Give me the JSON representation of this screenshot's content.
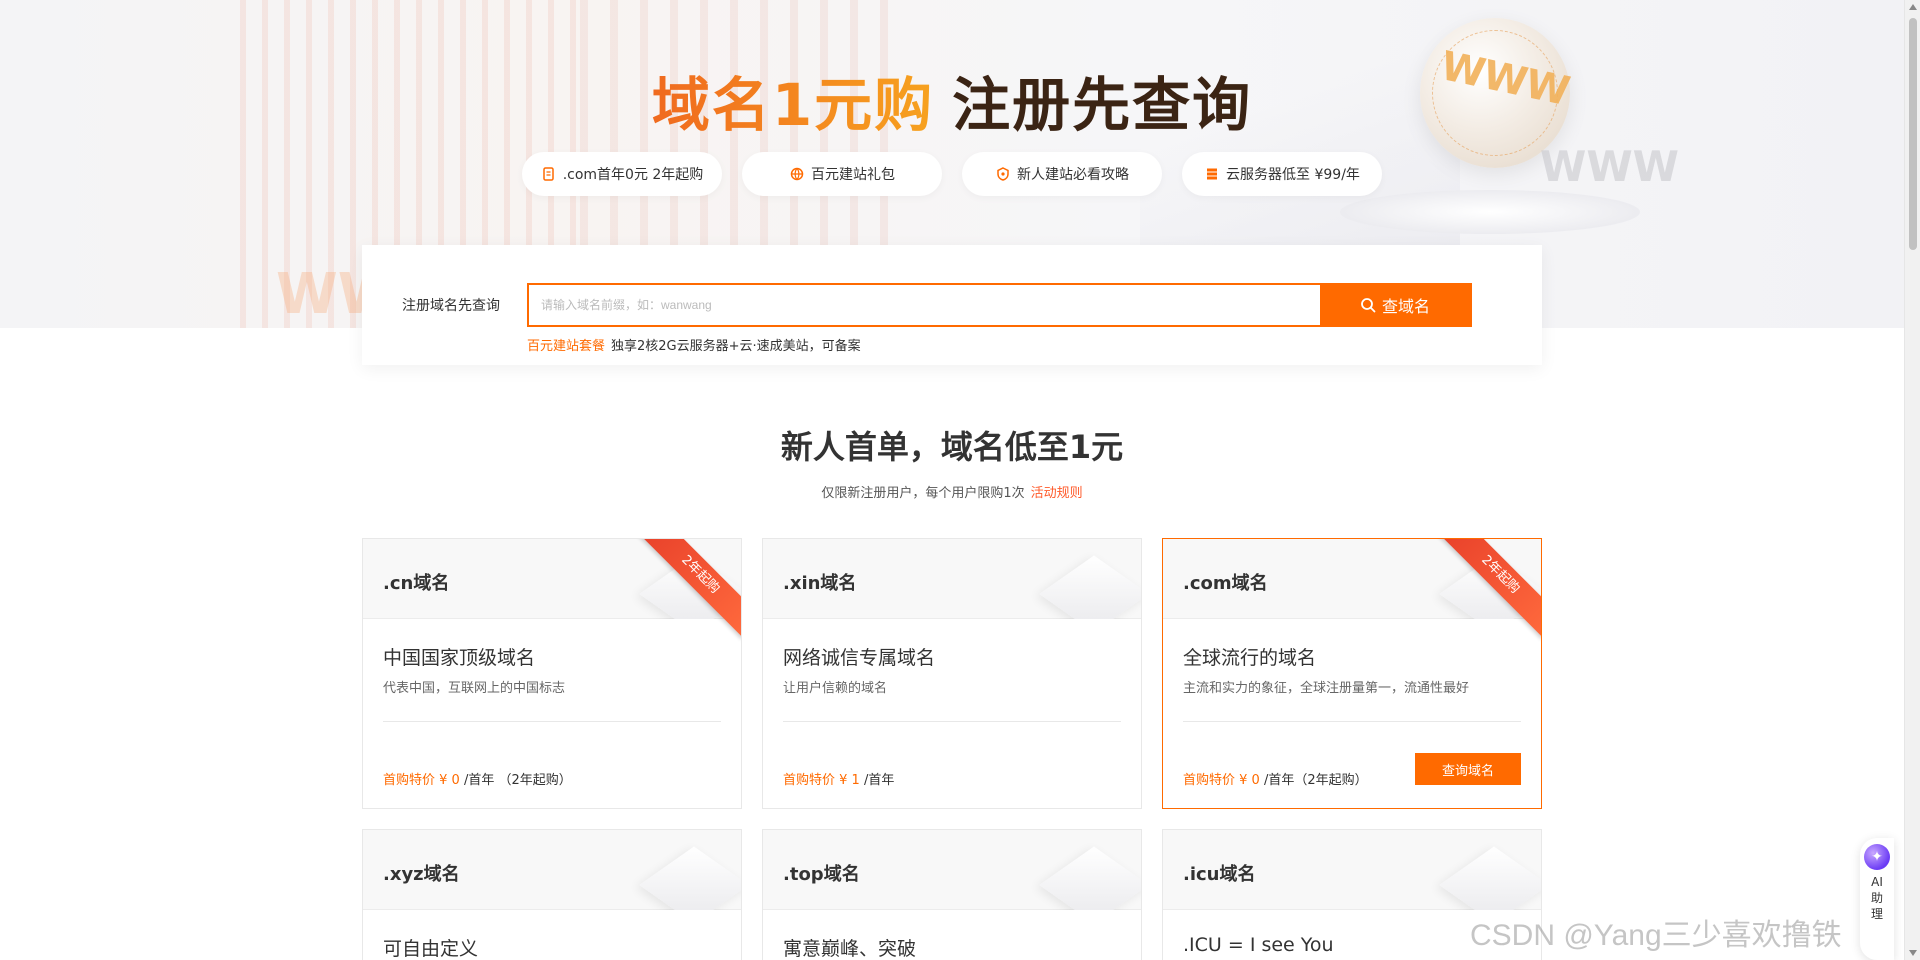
{
  "hero": {
    "headline_orange": "域名1元购",
    "headline_dark": "注册先查询",
    "deco_www": "WWW",
    "pills": [
      {
        "icon": "receipt-icon",
        "label": ".com首年0元 2年起购"
      },
      {
        "icon": "globe-icon",
        "label": "百元建站礼包"
      },
      {
        "icon": "shield-icon",
        "label": "新人建站必看攻略"
      },
      {
        "icon": "server-icon",
        "label": "云服务器低至 ¥99/年"
      }
    ]
  },
  "search": {
    "label": "注册域名先查询",
    "placeholder": "请输入域名前缀，如：wanwang",
    "button_label": "查域名",
    "tip_link": "百元建站套餐",
    "tip_text": "独享2核2G云服务器+云·速成美站，可备案"
  },
  "section": {
    "title": "新人首单，域名低至1元",
    "subtitle": "仅限新注册用户，每个用户限购1次",
    "rule_link": "活动规则"
  },
  "cards": [
    {
      "name": ".cn域名",
      "ribbon": "2年起购",
      "title": "中国国家顶级域名",
      "desc": "代表中国，互联网上的中国标志",
      "price_label": "首购特价 ¥ 0",
      "price_suffix": " /首年 （2年起购）",
      "button": ""
    },
    {
      "name": ".xin域名",
      "ribbon": "",
      "title": "网络诚信专属域名",
      "desc": "让用户信赖的域名",
      "price_label": "首购特价 ¥ 1",
      "price_suffix": " /首年",
      "button": ""
    },
    {
      "name": ".com域名",
      "ribbon": "2年起购",
      "title": "全球流行的域名",
      "desc": "主流和实力的象征，全球注册量第一，流通性最好",
      "price_label": "首购特价 ¥ 0",
      "price_suffix": " /首年（2年起购）",
      "button": "查询域名"
    },
    {
      "name": ".xyz域名",
      "ribbon": "",
      "title": "可自由定义",
      "desc": "",
      "price_label": "",
      "price_suffix": "",
      "button": ""
    },
    {
      "name": ".top域名",
      "ribbon": "",
      "title": "寓意巅峰、突破",
      "desc": "",
      "price_label": "",
      "price_suffix": "",
      "button": ""
    },
    {
      "name": ".icu域名",
      "ribbon": "",
      "title": ".ICU = I see You",
      "desc": "",
      "price_label": "",
      "price_suffix": "",
      "button": ""
    }
  ],
  "ai_assistant": {
    "label": "AI助理"
  },
  "watermark": "CSDN @Yang三少喜欢撸铁",
  "colors": {
    "accent": "#ff6a00",
    "ribbon": "#e8402a",
    "headline_dark": "#3b2414"
  }
}
